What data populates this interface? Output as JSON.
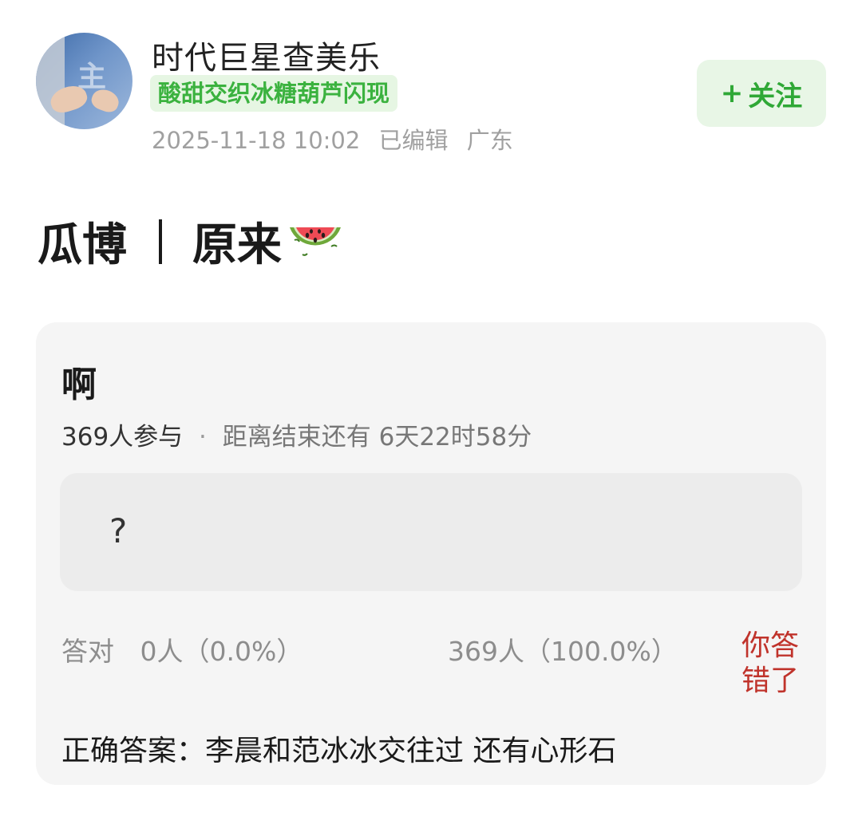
{
  "header": {
    "username": "时代巨星查美乐",
    "badge": "酸甜交织冰糖葫芦闪现",
    "timestamp": "2025-11-18 10:02",
    "edited": "已编辑",
    "location": "广东",
    "follow_plus": "+",
    "follow_label": "关注",
    "avatar_text": "主"
  },
  "post": {
    "title_left": "瓜博",
    "title_right": "原来",
    "title_emoji": "watermelon-icon"
  },
  "quiz": {
    "question": "啊",
    "participants": "369人参与",
    "dot": "·",
    "remaining": "距离结束还有 6天22时58分",
    "option": "?",
    "correct_label": "答对",
    "correct_count": "0人（0.0%）",
    "wrong_count": "369人（100.0%）",
    "result": "你答错了",
    "answer": "正确答案：李晨和范冰冰交往过 还有心形石"
  },
  "colors": {
    "accent_green": "#2fa836",
    "badge_green": "#3bb23f",
    "wrong_red": "#c0332b",
    "card_bg": "#f5f5f5"
  }
}
